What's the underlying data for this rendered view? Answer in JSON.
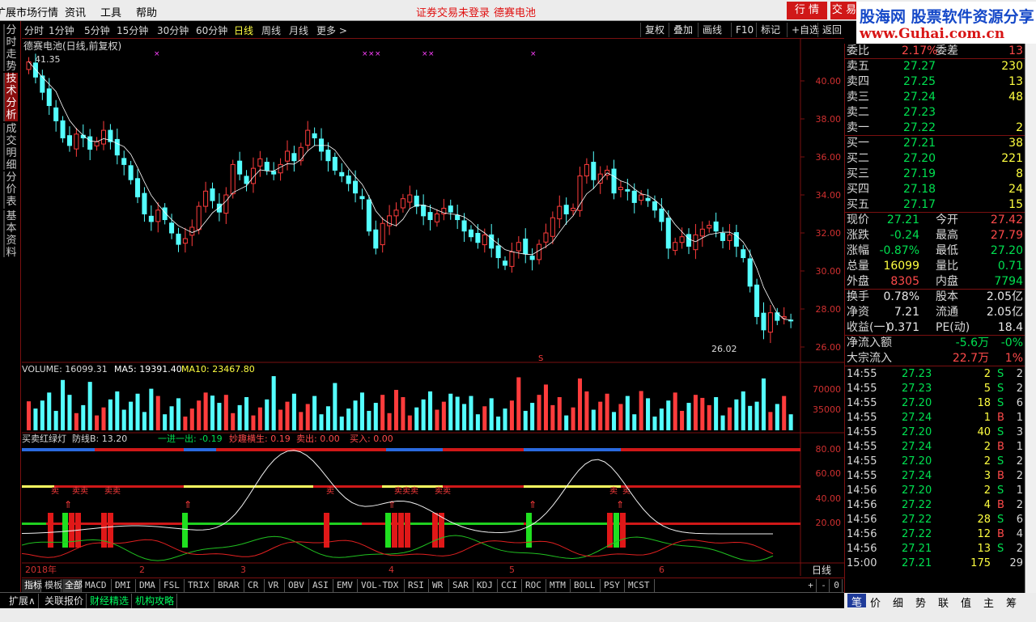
{
  "menu": {
    "items": [
      "扩展市场行情",
      "资讯",
      "工具",
      "帮助"
    ],
    "notice_login": "证券交易未登录",
    "notice_stock": "德赛电池",
    "btn_quotes": "行 情",
    "btn_trade": "交 易"
  },
  "logo": {
    "line1": "股海网 股票软件资源分享",
    "line2": "www.Guhai.com.cn"
  },
  "left_tabs": [
    "分时走势",
    "技术分析",
    "成交明细",
    "分价表",
    "基本资料"
  ],
  "period_bar": {
    "periods": [
      "分时",
      "1分钟",
      "5分钟",
      "15分钟",
      "30分钟",
      "60分钟",
      "日线",
      "周线",
      "月线",
      "更多 >"
    ],
    "active": "日线",
    "tools": [
      "复权",
      "叠加",
      "画线",
      "F10",
      "标记",
      "+自选",
      "返回"
    ]
  },
  "chart": {
    "title": "德赛电池(日线,前复权)",
    "high_label": "41.35",
    "low_label": "26.02",
    "price_axis": [
      "40.00",
      "38.00",
      "36.00",
      "34.00",
      "32.00",
      "30.00",
      "28.00",
      "26.00"
    ],
    "volume_header": {
      "volume": "VOLUME: 16099.31",
      "ma5": "MA5: 19391.40",
      "ma10": "MA10: 23467.80"
    },
    "volume_axis": [
      "70000",
      "35000"
    ],
    "indicator_header": {
      "name": "买卖红绿灯",
      "line_b": "防线B: 13.20",
      "jin": "一进一出: -0.19",
      "miao": "妙趣横生: 0.19",
      "sell": "卖出: 0.00",
      "buy": "买入: 0.00"
    },
    "indicator_axis": [
      "80.00",
      "60.00",
      "40.00",
      "20.00"
    ],
    "indicator_marks": [
      "卖",
      "卖卖",
      "卖卖",
      "卖",
      "卖卖卖",
      "卖卖",
      "卖",
      "卖"
    ],
    "x_axis": [
      "2018年",
      "2",
      "3",
      "4",
      "5",
      "6"
    ],
    "period_label": "日线",
    "s_mark": "S"
  },
  "indicator_tabs": [
    "指标",
    "模板",
    "全部",
    "MACD",
    "DMI",
    "DMA",
    "FSL",
    "TRIX",
    "BRAR",
    "CR",
    "VR",
    "OBV",
    "ASI",
    "EMV",
    "VOL-TDX",
    "RSI",
    "WR",
    "SAR",
    "KDJ",
    "CCI",
    "ROC",
    "MTM",
    "BOLL",
    "PSY",
    "MCST"
  ],
  "indicator_tabs_active": "全部",
  "zoom_controls": [
    "+",
    "-",
    "0"
  ],
  "bottom_tabs": [
    "扩展∧",
    "关联报价",
    "财经精选",
    "机构攻略"
  ],
  "quote": {
    "weibi_label": "委比",
    "weibi": "2.17%",
    "weicha_label": "委差",
    "weicha": "13",
    "asks": [
      {
        "label": "卖五",
        "price": "27.27",
        "vol": "230"
      },
      {
        "label": "卖四",
        "price": "27.25",
        "vol": "13"
      },
      {
        "label": "卖三",
        "price": "27.24",
        "vol": "48"
      },
      {
        "label": "卖二",
        "price": "27.23",
        "vol": ""
      },
      {
        "label": "卖一",
        "price": "27.22",
        "vol": "2"
      }
    ],
    "bids": [
      {
        "label": "买一",
        "price": "27.21",
        "vol": "38"
      },
      {
        "label": "买二",
        "price": "27.20",
        "vol": "221"
      },
      {
        "label": "买三",
        "price": "27.19",
        "vol": "8"
      },
      {
        "label": "买四",
        "price": "27.18",
        "vol": "24"
      },
      {
        "label": "买五",
        "price": "27.17",
        "vol": "15"
      }
    ],
    "stats": [
      {
        "l1": "现价",
        "v1": "27.21",
        "c1": "green",
        "l2": "今开",
        "v2": "27.42",
        "c2": "red"
      },
      {
        "l1": "涨跌",
        "v1": "-0.24",
        "c1": "green",
        "l2": "最高",
        "v2": "27.79",
        "c2": "red"
      },
      {
        "l1": "涨幅",
        "v1": "-0.87%",
        "c1": "green",
        "l2": "最低",
        "v2": "27.20",
        "c2": "green"
      },
      {
        "l1": "总量",
        "v1": "16099",
        "c1": "yellow",
        "l2": "量比",
        "v2": "0.71",
        "c2": "green"
      },
      {
        "l1": "外盘",
        "v1": "8305",
        "c1": "red",
        "l2": "内盘",
        "v2": "7794",
        "c2": "green"
      }
    ],
    "fund": [
      {
        "l1": "换手",
        "v1": "0.78%",
        "l2": "股本",
        "v2": "2.05亿"
      },
      {
        "l1": "净资",
        "v1": "7.21",
        "l2": "流通",
        "v2": "2.05亿"
      },
      {
        "l1": "收益(一)",
        "v1": "0.371",
        "l2": "PE(动)",
        "v2": "18.4"
      }
    ],
    "flow": [
      {
        "label": "净流入额",
        "val": "-5.6万",
        "pct": "-0%",
        "c": "green"
      },
      {
        "label": "大宗流入",
        "val": "22.7万",
        "pct": "1%",
        "c": "red"
      }
    ]
  },
  "ticks": [
    {
      "t": "14:55",
      "p": "27.23",
      "v": "2",
      "s": "S",
      "n": "2"
    },
    {
      "t": "14:55",
      "p": "27.23",
      "v": "5",
      "s": "S",
      "n": "2"
    },
    {
      "t": "14:55",
      "p": "27.20",
      "v": "18",
      "s": "S",
      "n": "6"
    },
    {
      "t": "14:55",
      "p": "27.24",
      "v": "1",
      "s": "B",
      "n": "1"
    },
    {
      "t": "14:55",
      "p": "27.20",
      "v": "40",
      "s": "S",
      "n": "3"
    },
    {
      "t": "14:55",
      "p": "27.24",
      "v": "2",
      "s": "B",
      "n": "1"
    },
    {
      "t": "14:55",
      "p": "27.20",
      "v": "2",
      "s": "S",
      "n": "2"
    },
    {
      "t": "14:55",
      "p": "27.24",
      "v": "3",
      "s": "B",
      "n": "2"
    },
    {
      "t": "14:56",
      "p": "27.20",
      "v": "2",
      "s": "S",
      "n": "1"
    },
    {
      "t": "14:56",
      "p": "27.22",
      "v": "4",
      "s": "B",
      "n": "2"
    },
    {
      "t": "14:56",
      "p": "27.22",
      "v": "28",
      "s": "S",
      "n": "6"
    },
    {
      "t": "14:56",
      "p": "27.22",
      "v": "12",
      "s": "B",
      "n": "4"
    },
    {
      "t": "14:56",
      "p": "27.21",
      "v": "13",
      "s": "S",
      "n": "2"
    },
    {
      "t": "15:00",
      "p": "27.21",
      "v": "175",
      "s": "",
      "n": "29"
    }
  ],
  "right_tabs": [
    "笔",
    "价",
    "细",
    "势",
    "联",
    "值",
    "主",
    "筹"
  ],
  "right_tabs_active": "笔",
  "colors": {
    "up": "#ff3c3c",
    "down": "#54ffff",
    "grid": "#7a1010",
    "ma": "#ffffff"
  }
}
